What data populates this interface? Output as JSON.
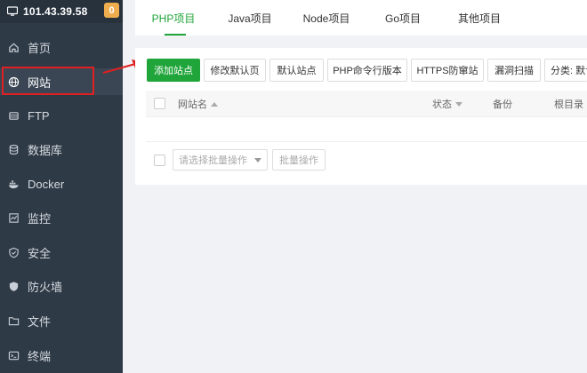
{
  "sidebar": {
    "host": "101.43.39.58",
    "badge": "0",
    "items": [
      {
        "label": "首页",
        "icon": "home-icon"
      },
      {
        "label": "网站",
        "icon": "globe-icon"
      },
      {
        "label": "FTP",
        "icon": "ftp-icon"
      },
      {
        "label": "数据库",
        "icon": "database-icon"
      },
      {
        "label": "Docker",
        "icon": "docker-icon"
      },
      {
        "label": "监控",
        "icon": "monitor-icon"
      },
      {
        "label": "安全",
        "icon": "shield-icon"
      },
      {
        "label": "防火墙",
        "icon": "firewall-icon"
      },
      {
        "label": "文件",
        "icon": "folder-icon"
      },
      {
        "label": "终端",
        "icon": "terminal-icon"
      }
    ]
  },
  "tabs": [
    {
      "label": "PHP项目"
    },
    {
      "label": "Java项目"
    },
    {
      "label": "Node项目"
    },
    {
      "label": "Go项目"
    },
    {
      "label": "其他项目"
    }
  ],
  "toolbar": {
    "add_site": "添加站点",
    "edit_default_page": "修改默认页",
    "default_site": "默认站点",
    "php_cli_version": "PHP命令行版本",
    "https_waf": "HTTPS防窜站",
    "vuln_scan": "漏洞扫描",
    "category": "分类: 默认"
  },
  "table": {
    "headers": {
      "site_name": "网站名",
      "status": "状态",
      "backup": "备份",
      "root_dir": "根目录"
    }
  },
  "batch": {
    "select_placeholder": "请选择批量操作",
    "button": "批量操作"
  },
  "colors": {
    "accent": "#20a53a",
    "sidebar_bg": "#2f3a47",
    "highlight": "#e02020",
    "badge": "#f0ad4e"
  }
}
